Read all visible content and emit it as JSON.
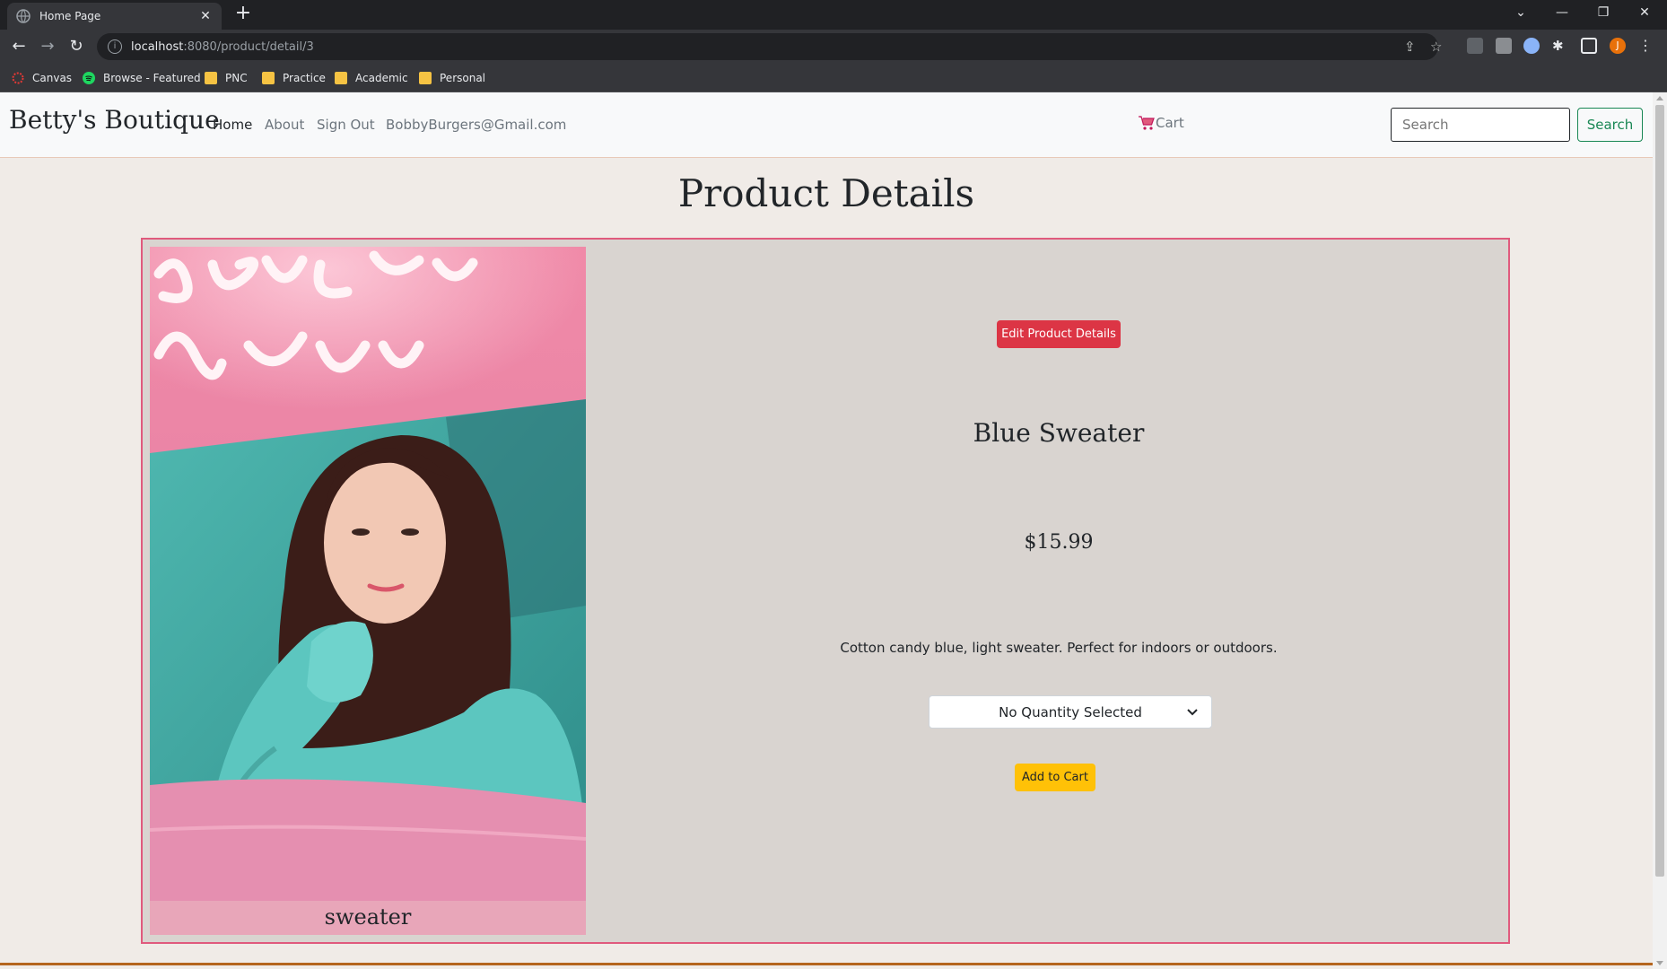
{
  "browser": {
    "tab_title": "Home Page",
    "url_host": "localhost",
    "url_rest": ":8080/product/detail/3",
    "bookmarks": [
      {
        "label": "Canvas",
        "icon": "canvas-icon"
      },
      {
        "label": "Browse - Featured",
        "icon": "spotify-icon"
      },
      {
        "label": "PNC",
        "icon": "folder-icon"
      },
      {
        "label": "Practice",
        "icon": "folder-icon"
      },
      {
        "label": "Academic",
        "icon": "folder-icon"
      },
      {
        "label": "Personal",
        "icon": "folder-icon"
      }
    ],
    "profile_initial": "J"
  },
  "navbar": {
    "brand": "Betty's Boutique",
    "links": [
      "Home",
      "About",
      "Sign Out",
      "BobbyBurgers@Gmail.com"
    ],
    "cart_label": "Cart",
    "search_placeholder": "Search",
    "search_button": "Search"
  },
  "page": {
    "heading": "Product Details"
  },
  "product": {
    "image_caption": "sweater",
    "edit_button": "Edit Product Details",
    "name": "Blue Sweater",
    "price": "$15.99",
    "description": "Cotton candy blue, light sweater. Perfect for indoors or outdoors.",
    "quantity_selected": "No Quantity Selected",
    "add_to_cart": "Add to Cart"
  },
  "colors": {
    "accent_border": "#e05a7d",
    "edit_button": "#dc3545",
    "add_button": "#ffc107",
    "search_button": "#198754"
  }
}
